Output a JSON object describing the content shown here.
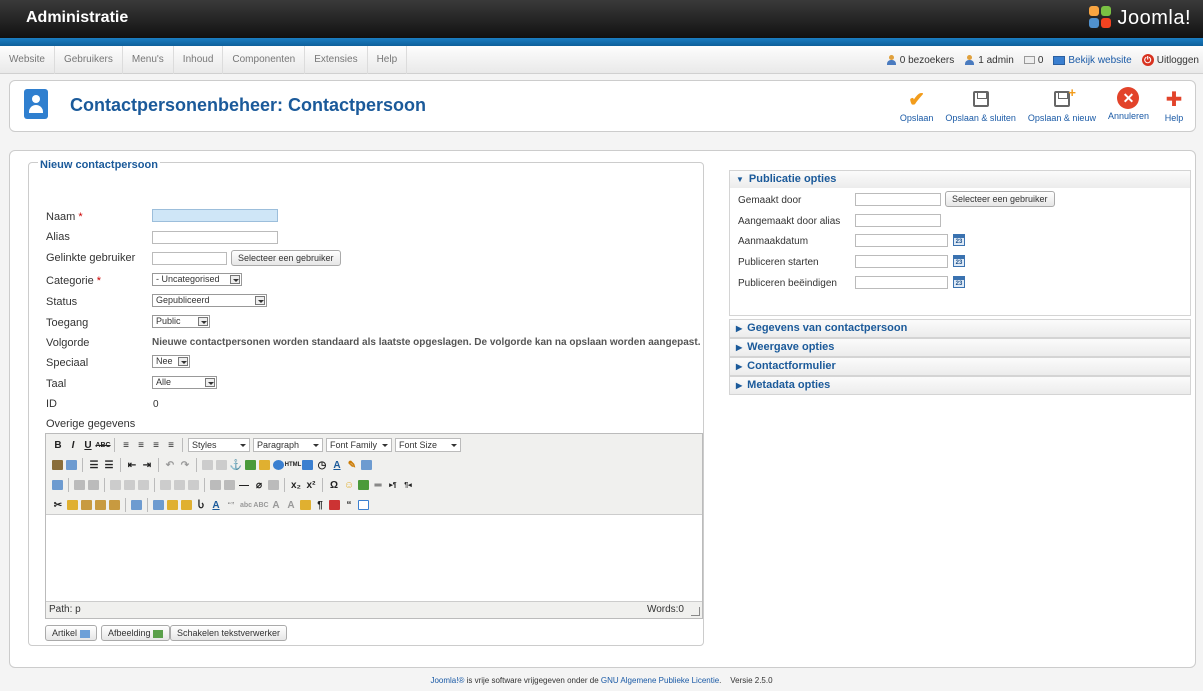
{
  "topbar": {
    "title": "Administratie",
    "logo_text": "Joomla!"
  },
  "menu": [
    "Website",
    "Gebruikers",
    "Menu's",
    "Inhoud",
    "Componenten",
    "Extensies",
    "Help"
  ],
  "status": {
    "visitors": "0 bezoekers",
    "admins": "1 admin",
    "messages": "0",
    "view_site": "Bekijk website",
    "logout": "Uitloggen"
  },
  "header": {
    "title": "Contactpersonenbeheer: Contactpersoon"
  },
  "toolbar": {
    "save": "Opslaan",
    "save_close": "Opslaan & sluiten",
    "save_new": "Opslaan & nieuw",
    "cancel": "Annuleren",
    "help": "Help"
  },
  "form": {
    "legend": "Nieuw contactpersoon",
    "name_label": "Naam",
    "name_value": "",
    "alias_label": "Alias",
    "alias_value": "",
    "linked_user_label": "Gelinkte gebruiker",
    "select_user_button": "Selecteer een gebruiker",
    "category_label": "Categorie",
    "category_value": "- Uncategorised",
    "status_label": "Status",
    "status_value": "Gepubliceerd",
    "access_label": "Toegang",
    "access_value": "Public",
    "order_label": "Volgorde",
    "order_text": "Nieuwe contactpersonen worden standaard als laatste opgeslagen. De volgorde kan na opslaan worden aangepast.",
    "featured_label": "Speciaal",
    "featured_value": "Nee",
    "language_label": "Taal",
    "language_value": "Alle",
    "id_label": "ID",
    "id_value": "0",
    "misc_label": "Overige gegevens"
  },
  "editor": {
    "styles": "Styles",
    "paragraph": "Paragraph",
    "font_family": "Font Family",
    "font_size": "Font Size",
    "path": "Path: p",
    "words": "Words:0"
  },
  "editor_buttons": {
    "article": "Artikel",
    "image": "Afbeelding",
    "toggle": "Schakelen tekstverwerker"
  },
  "publishing": {
    "title": "Publicatie opties",
    "created_by_label": "Gemaakt door",
    "created_by_value": "",
    "select_user_button": "Selecteer een gebruiker",
    "created_by_alias_label": "Aangemaakt door alias",
    "created_by_alias_value": "",
    "created_label": "Aanmaakdatum",
    "created_value": "",
    "publish_up_label": "Publiceren starten",
    "publish_up_value": "",
    "publish_down_label": "Publiceren beëindigen",
    "publish_down_value": ""
  },
  "panels": [
    "Gegevens van contactpersoon",
    "Weergave opties",
    "Contactformulier",
    "Metadata opties"
  ],
  "footer": {
    "brand": "Joomla!®",
    "text1": " is vrije software vrijgegeven onder de ",
    "license": "GNU Algemene Publieke Licentie",
    "text2": ".    Versie 2.5.0"
  }
}
